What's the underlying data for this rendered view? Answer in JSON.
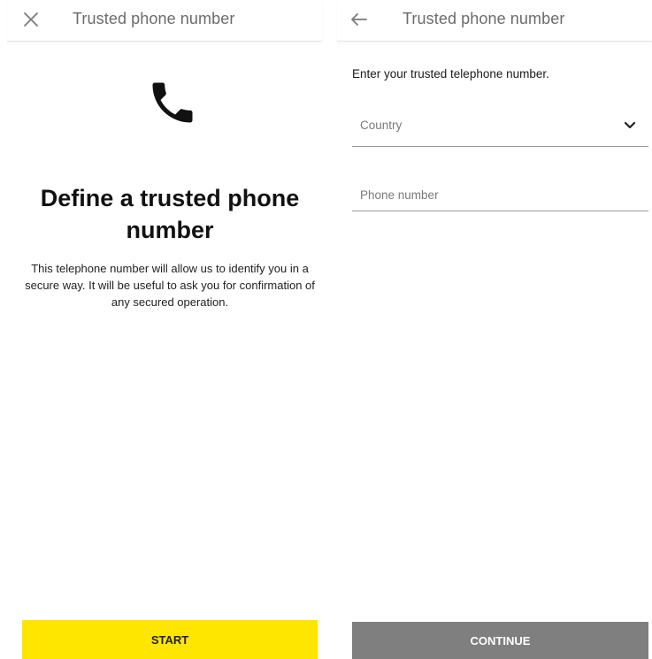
{
  "left_screen": {
    "header": {
      "title": "Trusted phone number",
      "close_icon": "close-icon"
    },
    "icon": "phone-icon",
    "title": "Define a trusted phone number",
    "description": "This telephone number will allow us to identify you in a secure way. It will be useful to ask you for confirmation of any secured operation.",
    "start_label": "START"
  },
  "right_screen": {
    "header": {
      "title": "Trusted phone number",
      "back_icon": "arrow-left-icon"
    },
    "instruction": "Enter your trusted telephone number.",
    "country": {
      "placeholder": "Country",
      "icon": "chevron-down-icon"
    },
    "phone": {
      "placeholder": "Phone number",
      "value": ""
    },
    "continue_label": "CONTINUE"
  },
  "colors": {
    "accent_yellow": "#FFE600",
    "disabled_gray": "#7F7F7F",
    "header_text": "#6B6B6B"
  }
}
